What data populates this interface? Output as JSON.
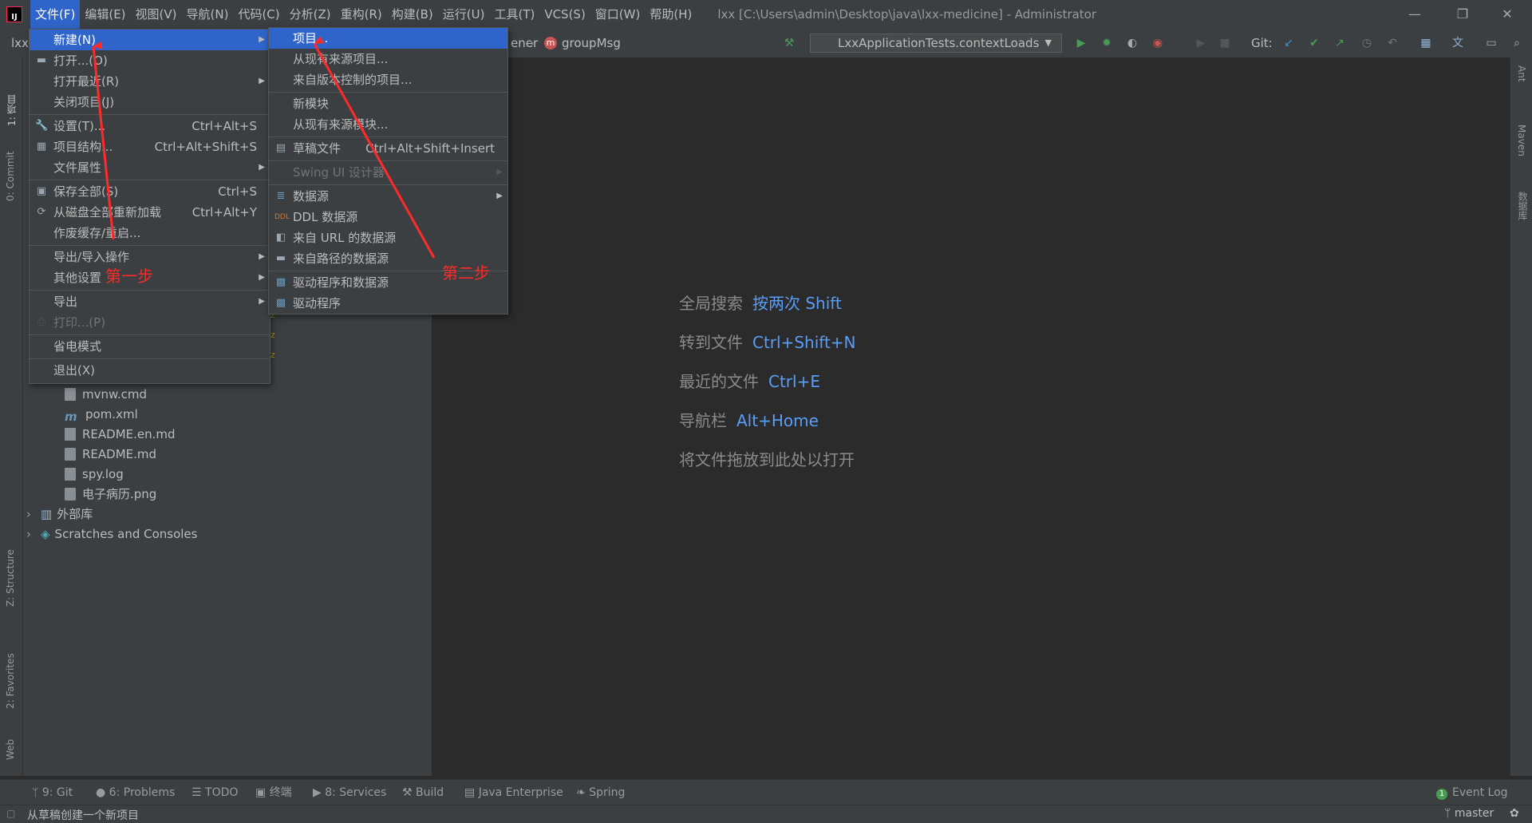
{
  "menubar": {
    "items": [
      "文件(F)",
      "编辑(E)",
      "视图(V)",
      "导航(N)",
      "代码(C)",
      "分析(Z)",
      "重构(R)",
      "构建(B)",
      "运行(U)",
      "工具(T)",
      "VCS(S)",
      "窗口(W)",
      "帮助(H)"
    ],
    "window_title": "lxx [C:\\Users\\admin\\Desktop\\java\\lxx-medicine] - Administrator"
  },
  "toolbar": {
    "project_short": "lxx",
    "breadcrumb_partial": "ener",
    "breadcrumb_file": "groupMsg",
    "run_config": "LxxApplicationTests.contextLoads",
    "git_label": "Git:"
  },
  "file_menu": {
    "items": [
      {
        "label": "新建(N)",
        "shortcut": "",
        "icon": "",
        "submenu": true,
        "selected": true
      },
      {
        "label": "打开...(O)",
        "shortcut": "",
        "icon": "folder-icon"
      },
      {
        "label": "打开最近(R)",
        "shortcut": "",
        "icon": "",
        "submenu": true
      },
      {
        "label": "关闭项目(J)",
        "shortcut": "",
        "icon": ""
      },
      {
        "label": "设置(T)...",
        "shortcut": "Ctrl+Alt+S",
        "icon": "wrench-icon"
      },
      {
        "label": "项目结构...",
        "shortcut": "Ctrl+Alt+Shift+S",
        "icon": "project-structure-icon"
      },
      {
        "label": "文件属性",
        "shortcut": "",
        "icon": "",
        "submenu": true
      },
      {
        "label": "保存全部(S)",
        "shortcut": "Ctrl+S",
        "icon": "save-icon"
      },
      {
        "label": "从磁盘全部重新加载",
        "shortcut": "Ctrl+Alt+Y",
        "icon": "reload-icon"
      },
      {
        "label": "作废缓存/重启...",
        "shortcut": "",
        "icon": ""
      },
      {
        "label": "导出/导入操作",
        "shortcut": "",
        "icon": "",
        "submenu": true
      },
      {
        "label": "其他设置",
        "shortcut": "",
        "icon": "",
        "submenu": true
      },
      {
        "label": "导出",
        "shortcut": "",
        "icon": "",
        "submenu": true
      },
      {
        "label": "打印...(P)",
        "shortcut": "",
        "icon": "print-icon",
        "disabled": true
      },
      {
        "label": "省电模式",
        "shortcut": "",
        "icon": ""
      },
      {
        "label": "退出(X)",
        "shortcut": "",
        "icon": ""
      }
    ]
  },
  "new_submenu": {
    "items": [
      {
        "label": "项目...",
        "shortcut": "",
        "icon": "",
        "selected": true
      },
      {
        "label": "从现有来源项目...",
        "shortcut": "",
        "icon": ""
      },
      {
        "label": "来自版本控制的项目...",
        "shortcut": "",
        "icon": ""
      },
      {
        "label": "新模块",
        "shortcut": "",
        "icon": ""
      },
      {
        "label": "从现有来源模块...",
        "shortcut": "",
        "icon": ""
      },
      {
        "label": "草稿文件",
        "shortcut": "Ctrl+Alt+Shift+Insert",
        "icon": "scratch-file-icon"
      },
      {
        "label": "Swing UI 设计器",
        "shortcut": "",
        "icon": "",
        "submenu": true,
        "disabled": true
      },
      {
        "label": "数据源",
        "shortcut": "",
        "icon": "database-icon",
        "submenu": true
      },
      {
        "label": "DDL 数据源",
        "shortcut": "",
        "icon": "ddl-icon"
      },
      {
        "label": "来自 URL 的数据源",
        "shortcut": "",
        "icon": "url-datasource-icon"
      },
      {
        "label": "来自路径的数据源",
        "shortcut": "",
        "icon": "folder-icon"
      },
      {
        "label": "驱动程序和数据源",
        "shortcut": "",
        "icon": "driver-datasource-icon"
      },
      {
        "label": "驱动程序",
        "shortcut": "",
        "icon": "driver-icon"
      }
    ]
  },
  "project_tree": {
    "files": [
      "mvnw.cmd",
      "pom.xml",
      "README.en.md",
      "README.md",
      "spy.log",
      "电子病历.png"
    ],
    "external_libraries": "外部库",
    "scratches": "Scratches and Consoles"
  },
  "editor_hints": [
    {
      "label": "全局搜索",
      "key": "按两次 Shift"
    },
    {
      "label": "转到文件",
      "key": "Ctrl+Shift+N"
    },
    {
      "label": "最近的文件",
      "key": "Ctrl+E"
    },
    {
      "label": "导航栏",
      "key": "Alt+Home"
    },
    {
      "label": "将文件拖放到此处以打开",
      "key": ""
    }
  ],
  "left_tabs": [
    "1: 项目",
    "0: Commit",
    "Z: Structure",
    "2: Favorites",
    "Web"
  ],
  "right_tabs": [
    "Ant",
    "Maven",
    "数据库"
  ],
  "bottom_tabs": [
    "9: Git",
    "6: Problems",
    "TODO",
    "终端",
    "8: Services",
    "Build",
    "Java Enterprise",
    "Spring"
  ],
  "event_log": {
    "count": "1",
    "label": "Event Log"
  },
  "statusbar": {
    "message": "从草稿创建一个新项目",
    "branch": "master"
  },
  "annotations": {
    "step1": "第一步",
    "step2": "第二步",
    "color": "#ff2a2a"
  },
  "colors": {
    "accent": "#2f65ca",
    "background": "#2b2b2b",
    "panel": "#3c3f41",
    "hint_key": "#589df6"
  }
}
